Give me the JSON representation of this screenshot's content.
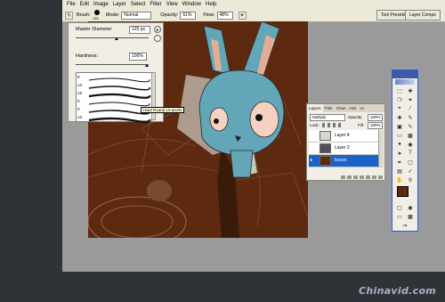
{
  "menu": [
    "File",
    "Edit",
    "Image",
    "Layer",
    "Select",
    "Filter",
    "View",
    "Window",
    "Help"
  ],
  "options_bar": {
    "brush_label": "Brush:",
    "brush_size": "125",
    "mode_label": "Mode:",
    "mode_value": "Normal",
    "opacity_label": "Opacity:",
    "opacity_value": "61%",
    "flow_label": "Flow:",
    "flow_value": "48%"
  },
  "palette_well": {
    "tool_presets": "Tool Presets",
    "layer_comps": "Layer Comps"
  },
  "brush_panel": {
    "master_diameter_label": "Master Diameter",
    "master_diameter_value": "125 px",
    "hardness_label": "Hardness:",
    "hardness_value": "100%",
    "brush_numbers": [
      "9",
      "13",
      "19",
      "5",
      "9",
      "13"
    ],
    "tooltip": "Hard Round 19 pixels"
  },
  "layers_panel": {
    "tabs": [
      "Layers",
      "Path",
      "Chan",
      "Hist",
      "Ac"
    ],
    "blend_mode": "Multiply",
    "opacity_label": "Opacity:",
    "opacity_value": "100%",
    "lock_label": "Lock:",
    "fill_label": "Fill:",
    "fill_value": "100%",
    "layers": [
      {
        "name": "Layer 4"
      },
      {
        "name": "Layer 2"
      },
      {
        "name": "brown"
      }
    ]
  },
  "watermark": "Chinavid.com",
  "colors": {
    "canvas_brown": "#5d2a10",
    "rabbit_blue": "#62a6b8",
    "selected_layer": "#1d62c9",
    "toolbox_border": "#3c5aa6"
  }
}
